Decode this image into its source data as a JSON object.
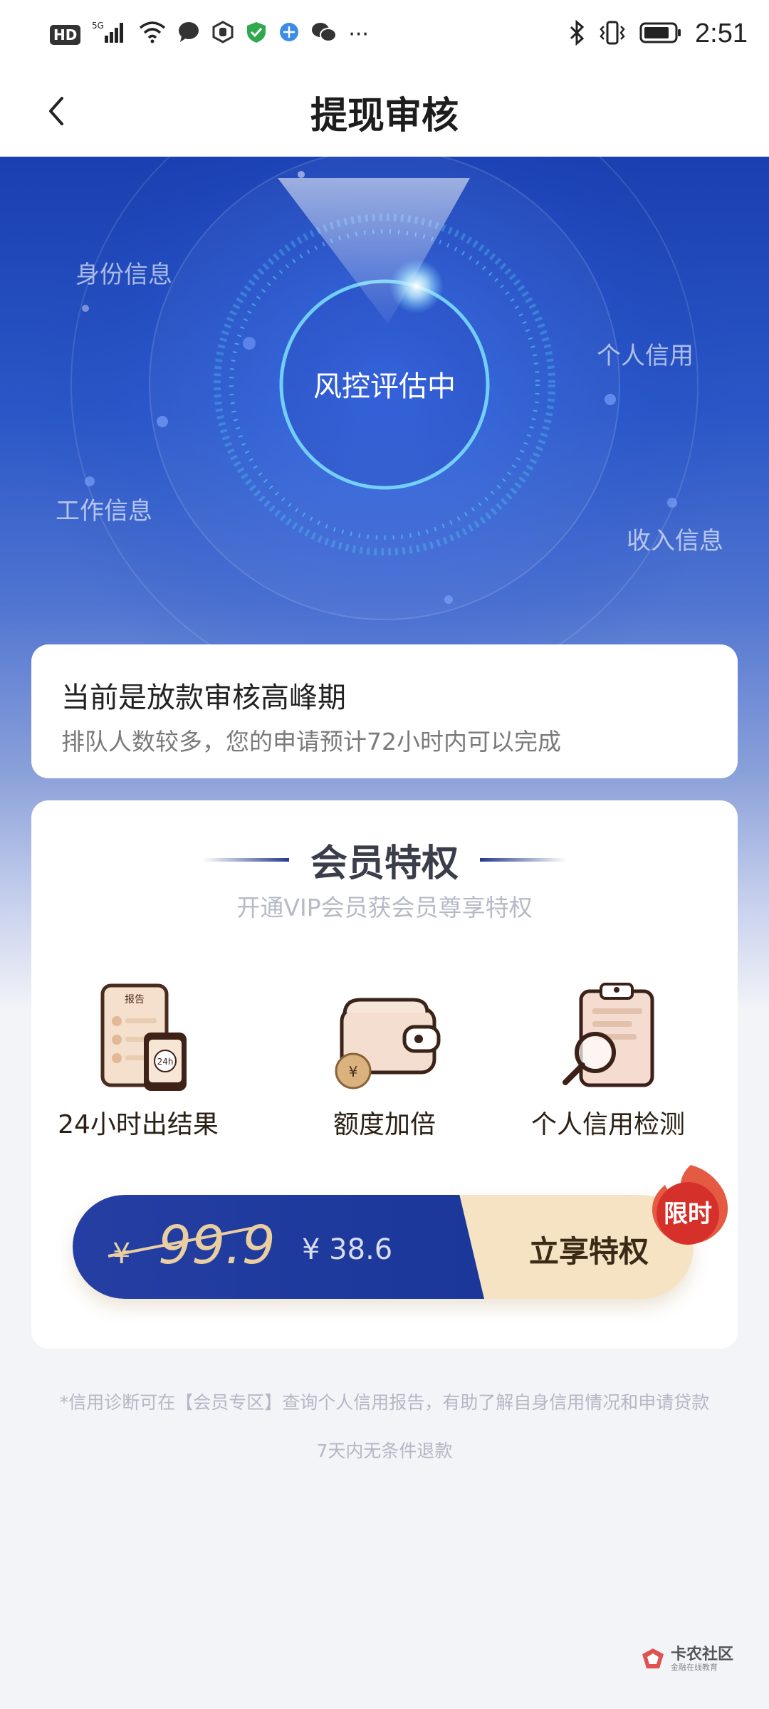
{
  "status_bar": {
    "left_icons": [
      "hd-icon",
      "signal-5g-icon",
      "wifi-icon",
      "message-icon",
      "shield-app-icon",
      "security-check-icon",
      "browser-icon",
      "wechat-icon",
      "more-dots-icon"
    ],
    "hd_label": "HD",
    "signal_label": "5G",
    "more_label": "···",
    "time": "2:51",
    "right_icons": [
      "bluetooth-icon",
      "vibrate-icon",
      "battery-icon"
    ]
  },
  "header": {
    "title": "提现审核",
    "back_icon": "chevron-left-icon"
  },
  "radar": {
    "center_text": "风控评估中",
    "labels": {
      "identity": "身份信息",
      "credit": "个人信用",
      "work": "工作信息",
      "income": "收入信息"
    }
  },
  "notice": {
    "title": "当前是放款审核高峰期",
    "subtitle": "排队人数较多，您的申请预计72小时内可以完成"
  },
  "vip": {
    "title": "会员特权",
    "subtitle": "开通VIP会员获会员尊享特权",
    "benefits": [
      {
        "label": "24小时出结果",
        "icon": "report-phone-icon",
        "icon_text": "报告",
        "badge_text": "24h"
      },
      {
        "label": "额度加倍",
        "icon": "wallet-icon",
        "icon_text": "¥"
      },
      {
        "label": "个人信用检测",
        "icon": "clipboard-magnifier-icon"
      }
    ],
    "cta": {
      "old_currency": "¥",
      "old_price": "99.9",
      "new_price": "¥ 38.6",
      "button_label": "立享特权",
      "badge": "限时"
    }
  },
  "footnote": "*信用诊断可在【会员专区】查询个人信用报告，有助了解自身信用情况和申请贷款",
  "footnote2": "7天内无条件退款",
  "watermark": {
    "main": "卡农社区",
    "sub": "金融在线教育"
  },
  "colors": {
    "primary_blue": "#1a3799",
    "gold": "#f6e3c3",
    "badge_red": "#d6302b"
  }
}
